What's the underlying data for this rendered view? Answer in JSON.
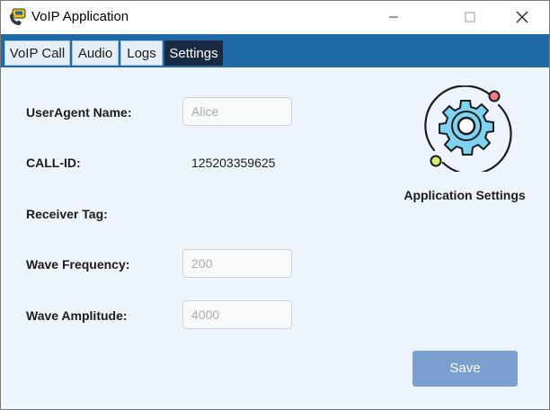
{
  "window": {
    "title": "VoIP Application",
    "icon": "voip-phone-app-icon",
    "controls": [
      "minimize-icon",
      "maximize-icon",
      "close-icon"
    ]
  },
  "tabs": [
    {
      "label": "VoIP Call",
      "active": false
    },
    {
      "label": "Audio",
      "active": false
    },
    {
      "label": "Logs",
      "active": false
    },
    {
      "label": "Settings",
      "active": true
    }
  ],
  "settings": {
    "useragent_label": "UserAgent Name:",
    "useragent_placeholder": "Alice",
    "callid_label": "CALL-ID:",
    "callid_value": "125203359625",
    "receiver_tag_label": "Receiver Tag:",
    "wave_frequency_label": "Wave Frequency:",
    "wave_frequency_placeholder": "200",
    "wave_amplitude_label": "Wave Amplitude:",
    "wave_amplitude_placeholder": "4000"
  },
  "panel": {
    "icon": "settings-gear-icon",
    "caption": "Application Settings"
  },
  "actions": {
    "save_label": "Save"
  },
  "colors": {
    "tabbar": "#1f6aa5",
    "active_tab": "#1a2a40",
    "content_bg": "#eef4fb",
    "save_button": "#7b9fd0",
    "gear_fill": "#7fd3f0"
  }
}
